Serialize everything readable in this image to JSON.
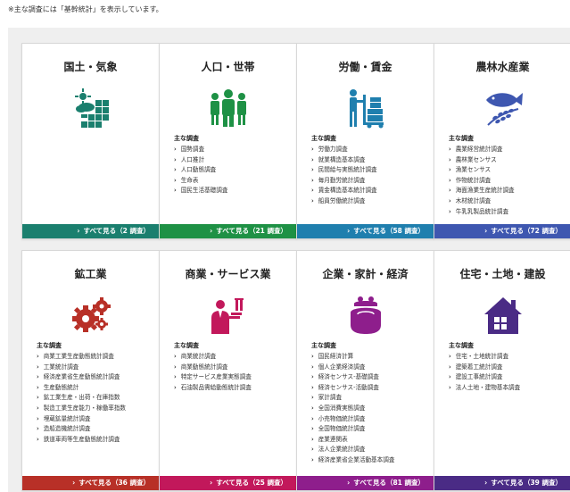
{
  "page": {
    "note": "※主な調査には「基幹統計」を表示しています。"
  },
  "common": {
    "list_heading": "主な調査",
    "arrow": "›"
  },
  "cards": [
    {
      "title": "国土・気象",
      "icon": "land-weather-icon",
      "color": "#1a7f6e",
      "surveys": [],
      "see_all": "すべて見る（2 調査）"
    },
    {
      "title": "人口・世帯",
      "icon": "population-icon",
      "color": "#1e9145",
      "surveys": [
        "国勢調査",
        "人口推計",
        "人口動態調査",
        "生命表",
        "国民生活基礎調査"
      ],
      "see_all": "すべて見る（21 調査）"
    },
    {
      "title": "労働・賃金",
      "icon": "labor-icon",
      "color": "#1f7fae",
      "surveys": [
        "労働力調査",
        "就業構造基本調査",
        "民間給与実態統計調査",
        "毎月勤労統計調査",
        "賃金構造基本統計調査",
        "船員労働統計調査"
      ],
      "see_all": "すべて見る（58 調査）"
    },
    {
      "title": "農林水産業",
      "icon": "agriculture-fishery-icon",
      "color": "#3e57b0",
      "surveys": [
        "農業経営統計調査",
        "農林業センサス",
        "漁業センサス",
        "作物統計調査",
        "海面漁業生産統計調査",
        "木材統計調査",
        "牛乳乳製品統計調査"
      ],
      "see_all": "すべて見る（72 調査）"
    },
    {
      "title": "鉱工業",
      "icon": "mining-industry-icon",
      "color": "#b83027",
      "surveys": [
        "商業工業生産動態統計調査",
        "工業統計調査",
        "経済産業省生産動態統計調査",
        "生産動態統計",
        "鉱工業生産・出荷・在庫指数",
        "製造工業生産能力・稼働率指数",
        "埋蔵鉱量統計調査",
        "造船造機統計調査",
        "鉄道車両等生産動態統計調査"
      ],
      "see_all": "すべて見る（36 調査）"
    },
    {
      "title": "商業・サービス業",
      "icon": "commerce-service-icon",
      "color": "#c2185b",
      "surveys": [
        "商業統計調査",
        "商業動態統計調査",
        "特定サービス産業実態調査",
        "石油製品需給動態統計調査"
      ],
      "see_all": "すべて見る（25 調査）"
    },
    {
      "title": "企業・家計・経済",
      "icon": "household-economy-icon",
      "color": "#8e1e8c",
      "surveys": [
        "国民経済計算",
        "個人企業経済調査",
        "経済センサス-基礎調査",
        "経済センサス-活動調査",
        "家計調査",
        "全国消費実態調査",
        "小売物価統計調査",
        "全国物価統計調査",
        "産業連関表",
        "法人企業統計調査",
        "経済産業省企業活動基本調査"
      ],
      "see_all": "すべて見る（81 調査）"
    },
    {
      "title": "住宅・土地・建設",
      "icon": "housing-land-icon",
      "color": "#4a2b85",
      "surveys": [
        "住宅・土地統計調査",
        "建築着工統計調査",
        "建設工事統計調査",
        "法人土地・建物基本調査"
      ],
      "see_all": "すべて見る（39 調査）"
    }
  ]
}
